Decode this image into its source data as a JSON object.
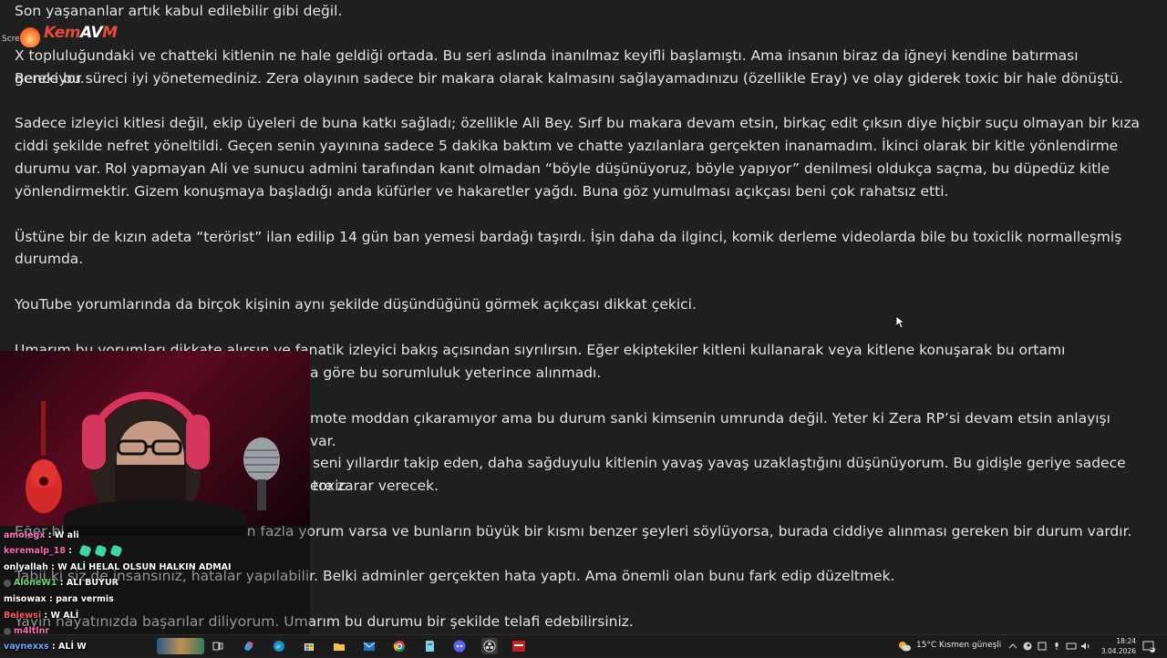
{
  "document": {
    "paragraphs": [
      "Son yaşananlar artık kabul edilebilir gibi değil.",
      "X topluluğundaki ve chatteki kitlenin ne hale geldiği ortada. Bu seri aslında inanılmaz keyifli başlamıştı. Ama insanın biraz da iğneyi kendine batırması gerekiyor.",
      "Bence bu süreci iyi yönetemediniz. Zera olayının sadece bir makara olarak kalmasını sağlayamadınızu (özellikle Eray) ve olay giderek toxic bir hale dönüştü.",
      "Sadece izleyici kitlesi değil, ekip üyeleri de buna katkı sağladı; özellikle Ali Bey. Sırf bu makara devam etsin, birkaç edit çıksın diye hiçbir suçu olmayan bir kıza",
      "ciddi şekilde nefret yöneltildi. Geçen senin yayınına sadece 5 dakika baktım ve chatte yazılanlara gerçekten inanamadım. İkinci olarak bir kitle yönlendirme",
      "durumu var. Rol yapmayan Ali ve sunucu admini tarafından kanıt olmadan “böyle düşünüyoruz, böyle yapıyor” denilmesi oldukça saçma, bu düpedüz kitle",
      "yönlendirmektir. Gizem konuşmaya başladığı anda küfürler ve hakaretler yağdı. Buna göz yumulması açıkçası beni çok rahatsız etti.",
      "Üstüne bir de kızın adeta “terörist” ilan edilip 14 gün ban yemesi bardağı taşırdı. İşin daha da ilginci, komik derleme videolarda bile bu toxiclik normalleşmiş",
      "durumda.",
      "YouTube yorumlarında da birçok kişinin aynı şekilde düşündüğünü görmek açıkçası dikkat çekici.",
      "Umarım bu yorumları dikkate alırsın ve fanatik izleyici bakış açısından sıyrılırsın. Eğer ekiptekiler kitleni kullanarak veya kitlene konuşarak bu ortamı körüklüyorsa,",
      "a göre bu sorumluluk yeterince alınmadı.",
      "mote moddan çıkaramıyor ama bu durum sanki kimsenin umrunda değil. Yeter ki Zera RP’si devam etsin anlayışı var.",
      "seni yıllardır takip eden, daha sağduyulu kitlenin yavaş yavaş uzaklaştığını düşünüyorum. Bu gidişle geriye sadece toxic",
      "ere zarar verecek.",
      "Eğer bir videonun altında 700’den fazla yorum varsa ve bunların büyük bir kısmı benzer şeyleri söylüyorsa, burada ciddiye alınması gereken bir durum vardır.",
      "Tabii ki siz de insansınız, hatalar yapılabilir. Belki adminler gerçekten hata yaptı. Ama önemli olan bunu fark edip düzeltmek.",
      "Yayın hayatınızda başarılar diliyorum. Umarım bu durumu bir şekilde telafi edebilirsiniz."
    ]
  },
  "overlay": {
    "logo_small": "Scree",
    "logo_text_a": "Kem",
    "logo_text_b": "AV",
    "logo_text_c": "M"
  },
  "chat": [
    {
      "user": "amolegx",
      "user_color": "#ff7ac8",
      "message": "W ali"
    },
    {
      "user": "keremalp_18",
      "user_color": "#ff6ab0",
      "message": ""
    },
    {
      "user": "onlyallah",
      "user_color": "#ffffff",
      "message": "W ALİ HELAL OLSUN HALKIN ADMAI"
    },
    {
      "user": "AloneW1",
      "user_color": "#6cd96c",
      "message": "ALI BUYUR"
    },
    {
      "user": "misowax",
      "user_color": "#ffffff",
      "message": "para vermis"
    },
    {
      "user": "Belewsi",
      "user_color": "#ff5a5a",
      "message": "W ALİ"
    },
    {
      "user": "m4ltlnr",
      "user_color": "#ff6ab0",
      "message": ""
    },
    {
      "user": "vaynexxs",
      "user_color": "#6aa8ff",
      "message": "ALİ W"
    }
  ],
  "taskbar": {
    "weather_temp": "15°C",
    "weather_text": "Kısmen güneşli",
    "time": "18:24",
    "date": "3.04.2026",
    "notification_count": "2",
    "icons": [
      "task-view-icon",
      "copilot-icon",
      "edge-icon",
      "store-icon",
      "file-explorer-icon",
      "mail-icon",
      "chrome-icon",
      "notepad-icon",
      "discord-icon",
      "obs-icon",
      "media-app-icon"
    ]
  }
}
